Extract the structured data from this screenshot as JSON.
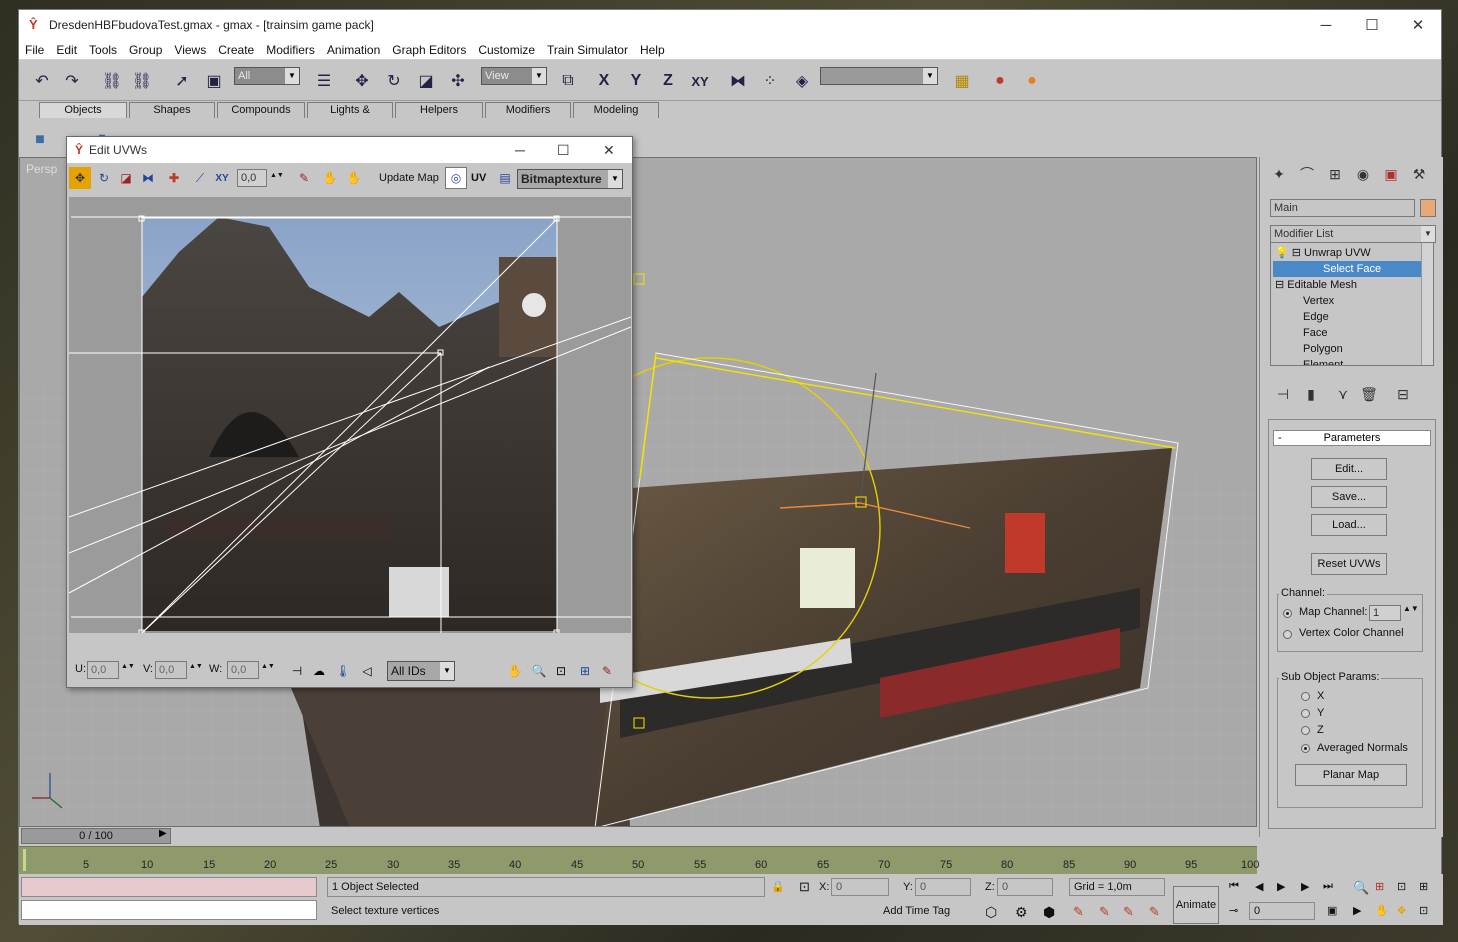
{
  "window": {
    "title": "DresdenHBFbudovaTest.gmax - gmax - [trainsim game pack]",
    "minimize": "─",
    "maximize": "☐",
    "close": "✕"
  },
  "menu": [
    "File",
    "Edit",
    "Tools",
    "Group",
    "Views",
    "Create",
    "Modifiers",
    "Animation",
    "Graph Editors",
    "Customize",
    "Train Simulator",
    "Help"
  ],
  "toolbar": {
    "selection_filter": "All",
    "ref_coord": "View",
    "axis_x": "X",
    "axis_y": "Y",
    "axis_z": "Z",
    "axis_xy": "XY",
    "named_selection": ""
  },
  "tabs": [
    "Objects",
    "Shapes",
    "Compounds",
    "Lights & Cameras",
    "Helpers",
    "Modifiers",
    "Modeling"
  ],
  "viewport": {
    "label": "Persp"
  },
  "uvw_editor": {
    "title": "Edit UVWs",
    "spinner_value": "0,0",
    "update_map": "Update Map",
    "uv_label": "UV",
    "map_select": "Bitmaptexture",
    "u_label": "U:",
    "u_value": "0,0",
    "v_label": "V:",
    "v_value": "0,0",
    "w_label": "W:",
    "w_value": "0,0",
    "ids_select": "All IDs"
  },
  "command_panel": {
    "object_name": "Main",
    "modifier_list": "Modifier List",
    "stack": [
      {
        "label": "Unwrap UVW",
        "indent": 0,
        "expander": "⊟",
        "bulb": true,
        "selected": false
      },
      {
        "label": "Select Face",
        "indent": 2,
        "expander": "",
        "bulb": false,
        "selected": true
      },
      {
        "label": "Editable Mesh",
        "indent": 0,
        "expander": "⊟",
        "bulb": false,
        "selected": false
      },
      {
        "label": "Vertex",
        "indent": 1,
        "expander": "",
        "bulb": false,
        "selected": false
      },
      {
        "label": "Edge",
        "indent": 1,
        "expander": "",
        "bulb": false,
        "selected": false
      },
      {
        "label": "Face",
        "indent": 1,
        "expander": "",
        "bulb": false,
        "selected": false
      },
      {
        "label": "Polygon",
        "indent": 1,
        "expander": "",
        "bulb": false,
        "selected": false
      },
      {
        "label": "Element",
        "indent": 1,
        "expander": "",
        "bulb": false,
        "selected": false
      }
    ],
    "rollout_toggle": "-",
    "rollout_title": "Parameters",
    "edit_button": "Edit...",
    "save_button": "Save...",
    "load_button": "Load...",
    "reset_button": "Reset UVWs",
    "channel_group": "Channel:",
    "map_channel_label": "Map Channel:",
    "map_channel_value": "1",
    "vertex_color_label": "Vertex Color Channel",
    "subobj_group": "Sub Object Params:",
    "axis_options": [
      "X",
      "Y",
      "Z",
      "Averaged Normals"
    ],
    "axis_selected": 3,
    "planar_map_button": "Planar Map"
  },
  "timeline": {
    "slider_label": "0 / 100",
    "ticks": [
      "5",
      "10",
      "15",
      "20",
      "25",
      "30",
      "35",
      "40",
      "45",
      "50",
      "55",
      "60",
      "65",
      "70",
      "75",
      "80",
      "85",
      "90",
      "95",
      "100"
    ]
  },
  "status": {
    "selection": "1 Object Selected",
    "prompt": "Select texture vertices",
    "x_label": "X:",
    "x_value": "0",
    "y_label": "Y:",
    "y_value": "0",
    "z_label": "Z:",
    "z_value": "0",
    "grid": "Grid = 1,0m",
    "add_time_tag": "Add Time Tag",
    "animate": "Animate",
    "frame": "0"
  }
}
